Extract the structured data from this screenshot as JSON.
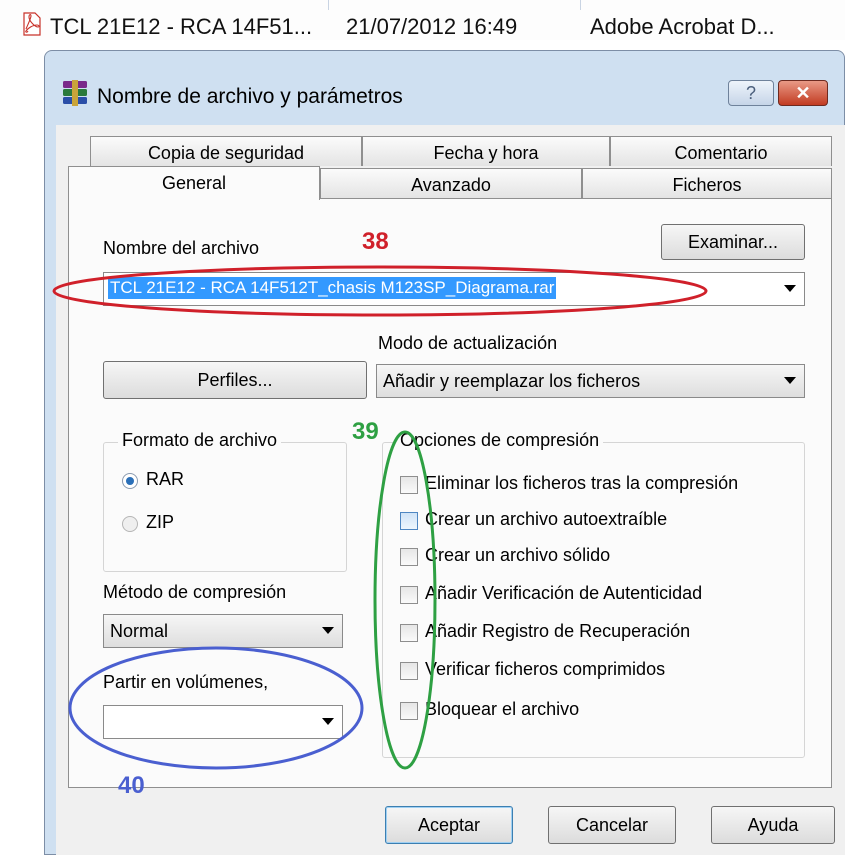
{
  "background_row": {
    "file_name": "TCL 21E12 - RCA 14F51...",
    "date_modified": "21/07/2012 16:49",
    "type": "Adobe Acrobat D..."
  },
  "dialog": {
    "title": "Nombre de archivo y parámetros",
    "help_glyph": "?",
    "close_glyph": "✕"
  },
  "tabs": {
    "row_back": [
      "Copia de seguridad",
      "Fecha y hora",
      "Comentario"
    ],
    "row_front": [
      "General",
      "Avanzado",
      "Ficheros"
    ],
    "active": "General"
  },
  "general": {
    "archive_name_label": "Nombre del archivo",
    "browse_button": "Examinar...",
    "archive_name_value": "TCL 21E12 - RCA 14F512T_chasis M123SP_Diagrama.rar",
    "profiles_button": "Perfiles...",
    "update_mode_label": "Modo de actualización",
    "update_mode_value": "Añadir y reemplazar los ficheros",
    "format_group_title": "Formato de archivo",
    "format_rar": "RAR",
    "format_zip": "ZIP",
    "method_label": "Método de compresión",
    "method_value": "Normal",
    "split_label": "Partir en volúmenes,",
    "split_value": "",
    "options_group_title": "Opciones de compresión",
    "options": [
      {
        "label": "Eliminar los ficheros tras la compresión",
        "checked": false
      },
      {
        "label": "Crear un archivo autoextraíble",
        "checked": false
      },
      {
        "label": "Crear un archivo sólido",
        "checked": false
      },
      {
        "label": "Añadir Verificación de Autenticidad",
        "checked": false
      },
      {
        "label": "Añadir Registro de Recuperación",
        "checked": false
      },
      {
        "label": "Verificar ficheros comprimidos",
        "checked": false
      },
      {
        "label": "Bloquear el archivo",
        "checked": false
      }
    ]
  },
  "buttons": {
    "ok": "Aceptar",
    "cancel": "Cancelar",
    "help": "Ayuda"
  },
  "annotations": {
    "n38": "38",
    "n39": "39",
    "n40": "40",
    "colors": {
      "red": "#d0202a",
      "green": "#2ea043",
      "blue": "#4a5fd0"
    }
  }
}
